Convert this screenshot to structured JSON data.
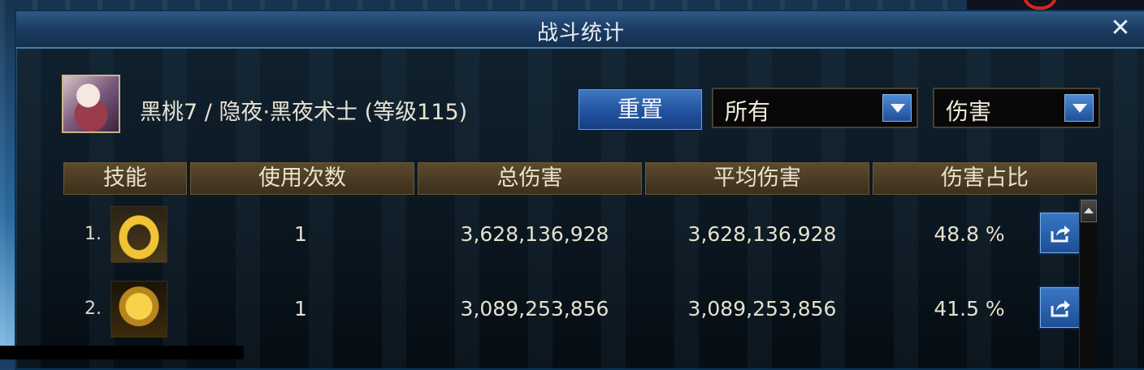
{
  "window": {
    "title": "战斗统计",
    "close_glyph": "✕"
  },
  "character": {
    "display": "黑桃7 / 隐夜·黑夜术士 (等级115)"
  },
  "controls": {
    "reset_label": "重置",
    "filter_target": "所有",
    "filter_type": "伤害"
  },
  "table": {
    "headers": [
      "技能",
      "使用次数",
      "总伤害",
      "平均伤害",
      "伤害占比"
    ],
    "rows": [
      {
        "rank": "1.",
        "skill_icon": "golden-ring-skill-icon",
        "uses": "1",
        "total": "3,628,136,928",
        "average": "3,628,136,928",
        "percent": "48.8 %"
      },
      {
        "rank": "2.",
        "skill_icon": "golden-beast-skill-icon",
        "uses": "1",
        "total": "3,089,253,856",
        "average": "3,089,253,856",
        "percent": "41.5 %"
      }
    ]
  },
  "colors": {
    "accent_blue": "#2252a0",
    "header_bronze": "#5c4a2c",
    "text_light": "#e6e0cf"
  }
}
